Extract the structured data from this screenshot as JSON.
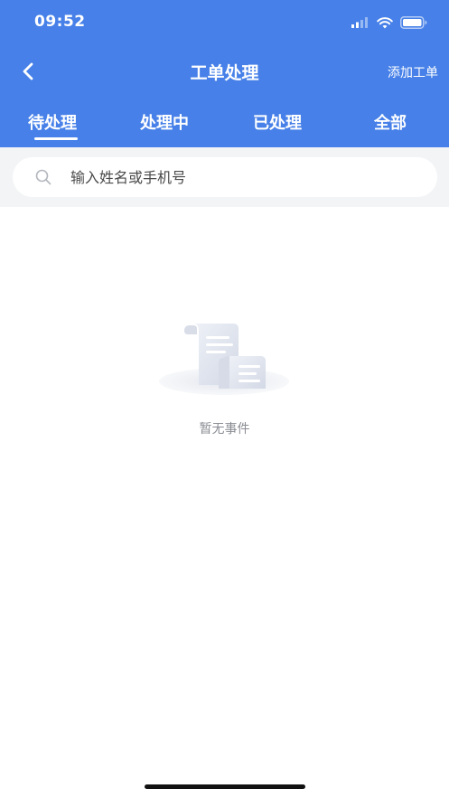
{
  "status_bar": {
    "time": "09:52"
  },
  "nav": {
    "title": "工单处理",
    "action_label": "添加工单"
  },
  "tabs": [
    {
      "label": "待处理",
      "active": true
    },
    {
      "label": "处理中",
      "active": false
    },
    {
      "label": "已处理",
      "active": false
    },
    {
      "label": "全部",
      "active": false
    }
  ],
  "search": {
    "placeholder": "输入姓名或手机号",
    "value": ""
  },
  "empty_state": {
    "message": "暂无事件"
  },
  "colors": {
    "primary": "#4680e8",
    "search_bg": "#f3f4f6",
    "muted_text": "#8a8d93"
  }
}
